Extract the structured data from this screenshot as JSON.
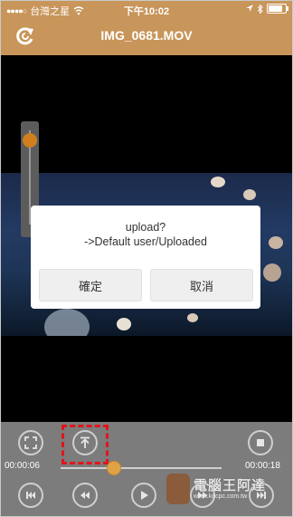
{
  "status_bar": {
    "carrier": "台灣之星",
    "time": "下午10:02",
    "battery_percent": 0.85
  },
  "header": {
    "title": "IMG_0681.MOV"
  },
  "player": {
    "volume_level": 0.95,
    "progress_fraction": 0.33
  },
  "dialog": {
    "line1": "upload?",
    "line2": "->Default user/Uploaded",
    "confirm_label": "確定",
    "cancel_label": "取消"
  },
  "controls": {
    "current_time": "00:00:06",
    "total_time": "00:00:18"
  },
  "watermark": {
    "text": "電腦王阿達",
    "url": "www.kocpc.com.tw"
  },
  "colors": {
    "bar": "#c8955a",
    "accent": "#d07f1e",
    "highlight": "#e2141b"
  },
  "icons": [
    "refresh-icon",
    "fullscreen-icon",
    "upload-icon",
    "stop-icon",
    "skip-start-icon",
    "rewind-icon",
    "play-icon",
    "fast-forward-icon",
    "skip-end-icon"
  ]
}
